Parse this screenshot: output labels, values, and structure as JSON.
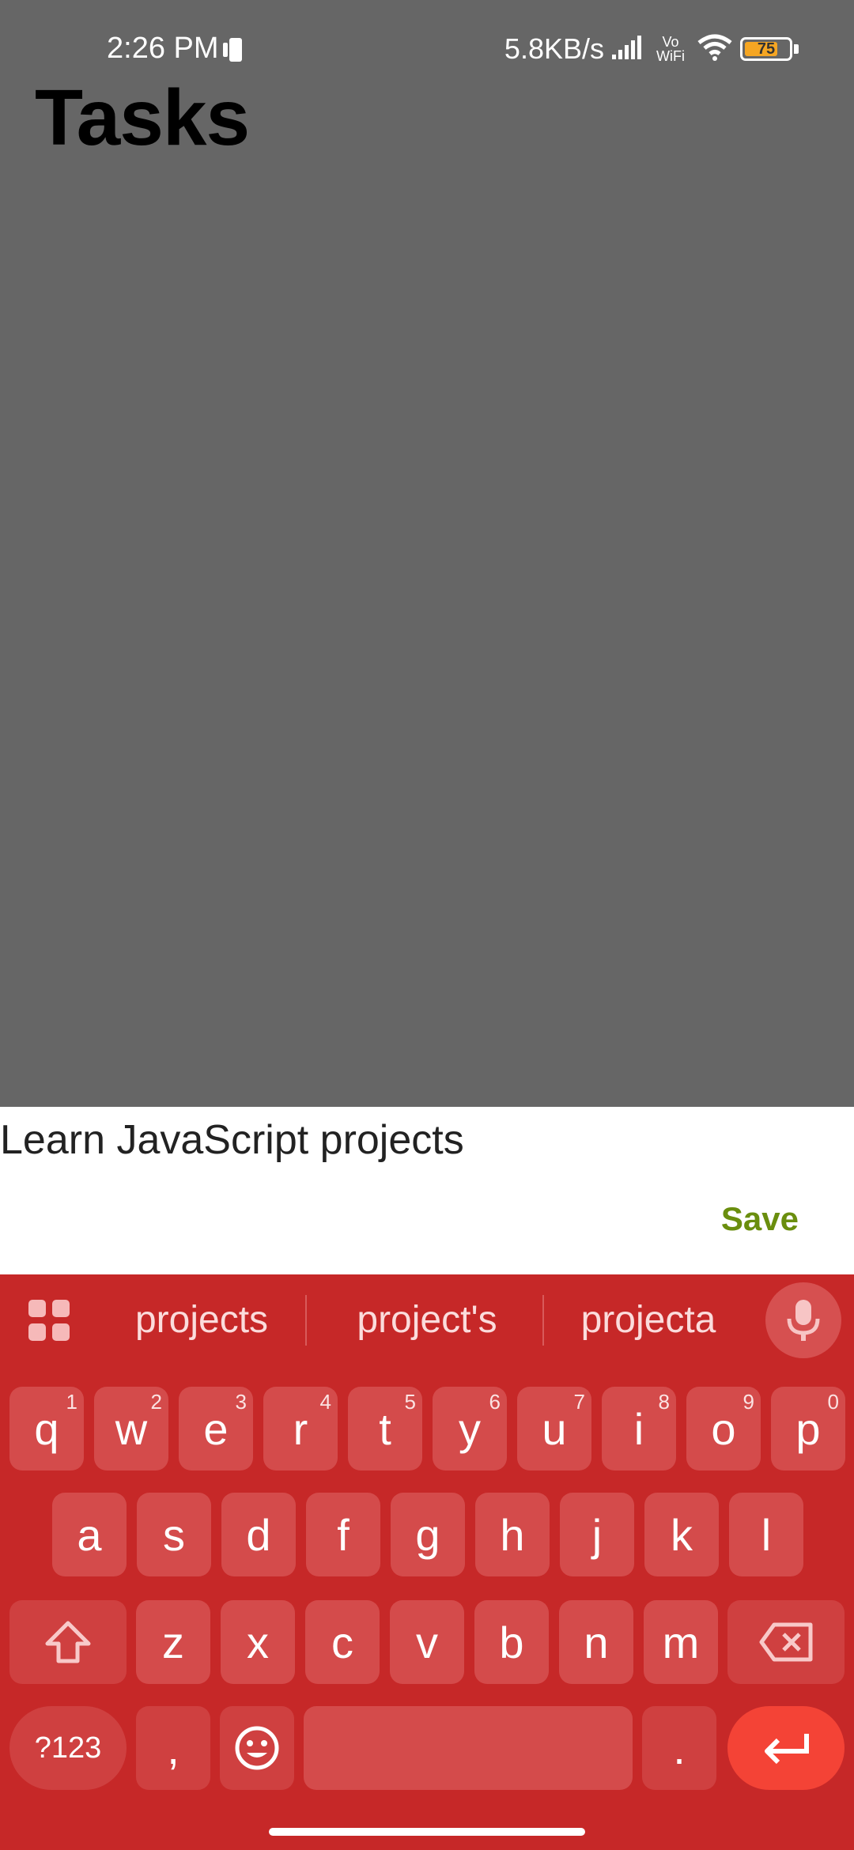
{
  "status_bar": {
    "time": "2:26 PM",
    "network_speed": "5.8KB/s",
    "vowifi_line1": "Vo",
    "vowifi_line2": "WiFi",
    "battery_level": "75",
    "battery_fraction": 0.75,
    "icons": [
      "phone-icon",
      "signal-icon",
      "wifi-icon",
      "battery-icon"
    ]
  },
  "header": {
    "title": "Tasks"
  },
  "task_input": {
    "value": "Learn JavaScript projects"
  },
  "actions": {
    "save_label": "Save"
  },
  "keyboard": {
    "suggestions": [
      "projects",
      "project's",
      "projecta"
    ],
    "row1": [
      {
        "key": "q",
        "hint": "1"
      },
      {
        "key": "w",
        "hint": "2"
      },
      {
        "key": "e",
        "hint": "3"
      },
      {
        "key": "r",
        "hint": "4"
      },
      {
        "key": "t",
        "hint": "5"
      },
      {
        "key": "y",
        "hint": "6"
      },
      {
        "key": "u",
        "hint": "7"
      },
      {
        "key": "i",
        "hint": "8"
      },
      {
        "key": "o",
        "hint": "9"
      },
      {
        "key": "p",
        "hint": "0"
      }
    ],
    "row2": [
      "a",
      "s",
      "d",
      "f",
      "g",
      "h",
      "j",
      "k",
      "l"
    ],
    "row3": [
      "z",
      "x",
      "c",
      "v",
      "b",
      "n",
      "m"
    ],
    "symbols_label": "?123",
    "comma_label": ",",
    "period_label": ".",
    "colors": {
      "background": "#c62828",
      "key": "#d44b4b",
      "enter": "#f44336"
    }
  }
}
